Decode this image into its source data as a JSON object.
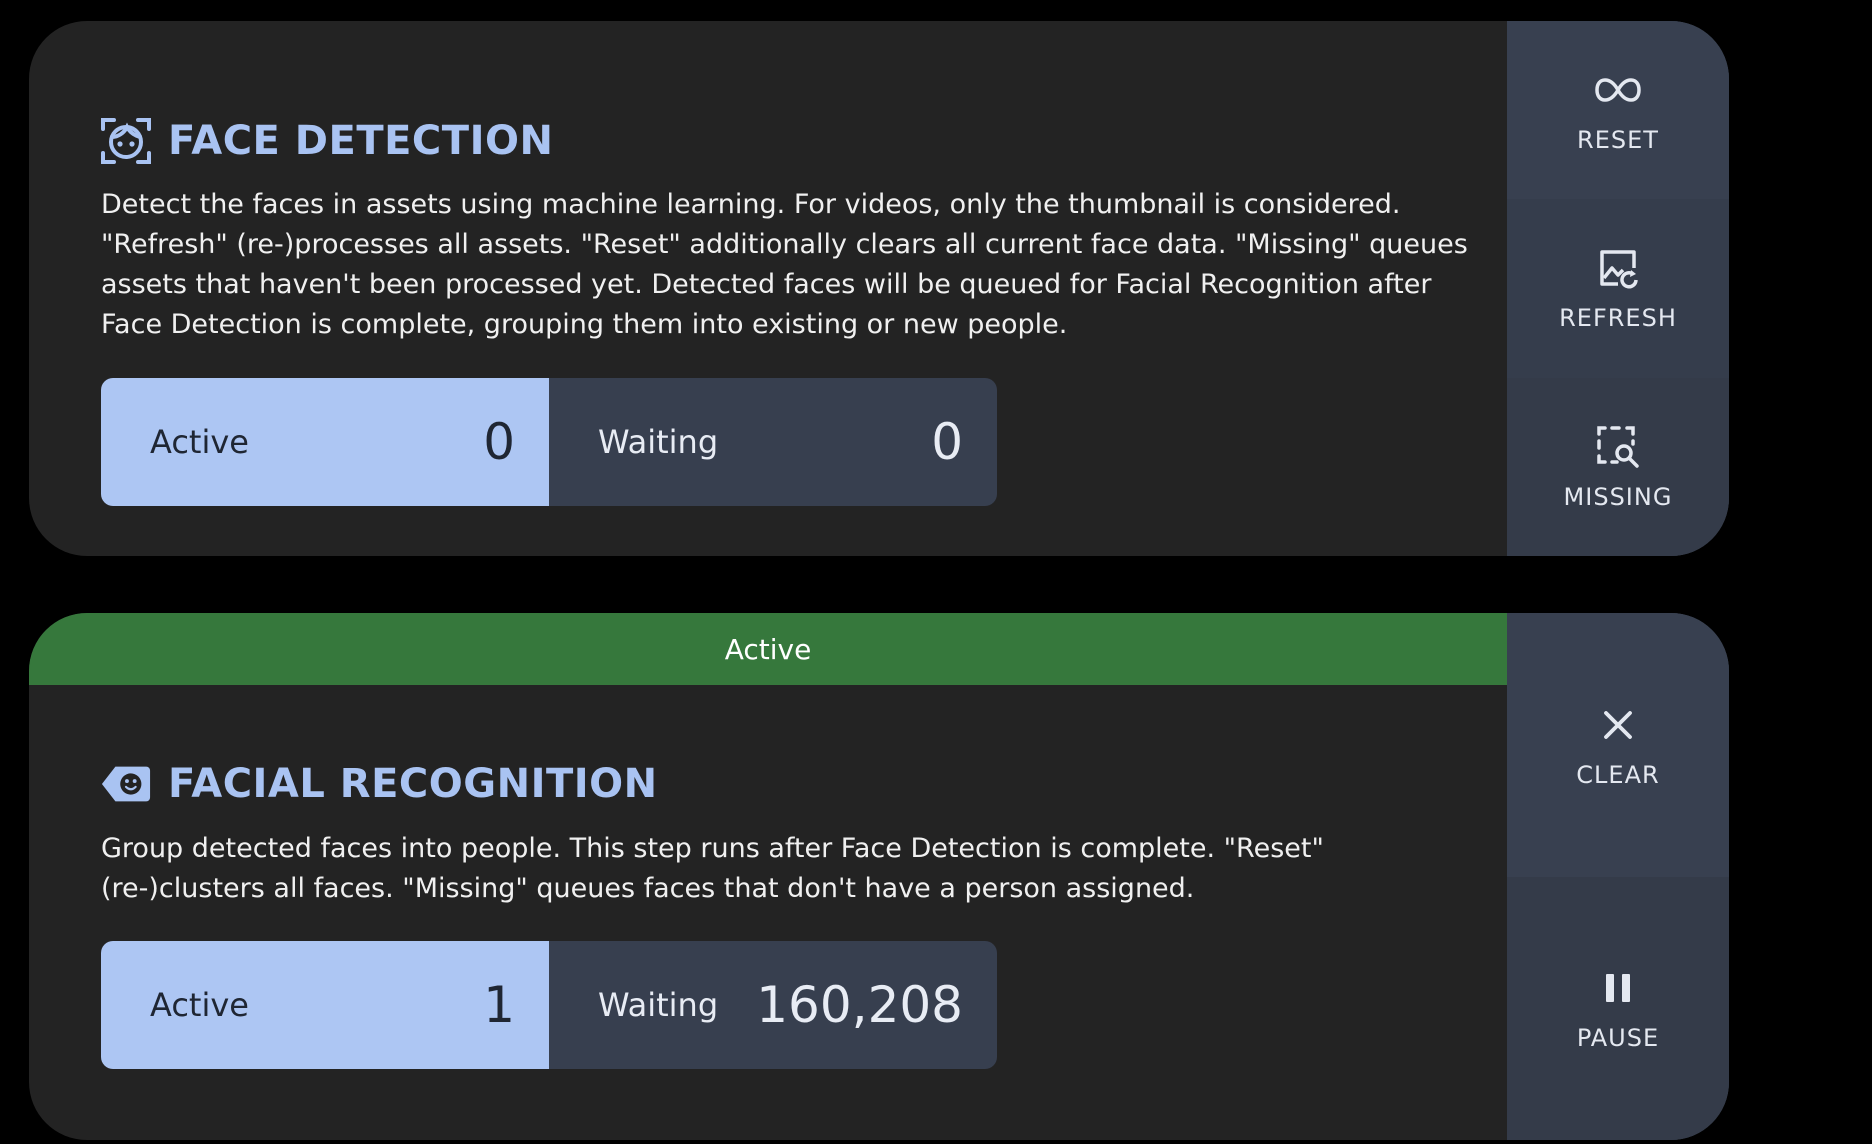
{
  "colors": {
    "background": "#000000",
    "card": "#232323",
    "accent": "#a9c3f2",
    "active_box": "#adc6f3",
    "waiting_box": "#373f4f",
    "side_panel": "#353d4d",
    "status_active": "#36783c"
  },
  "jobs": [
    {
      "title": "FACE DETECTION",
      "icon": "face-scan-icon",
      "description": "Detect the faces in assets using machine learning. For videos, only the thumbnail is considered. \"Refresh\" (re-)processes all assets. \"Reset\" additionally clears all current face data. \"Missing\" queues assets that haven't been processed yet. Detected faces will be queued for Facial Recognition after Face Detection is complete, grouping them into existing or new people.",
      "active_label": "Active",
      "active_count": "0",
      "waiting_label": "Waiting",
      "waiting_count": "0",
      "actions": [
        {
          "label": "RESET",
          "icon": "infinity-icon"
        },
        {
          "label": "REFRESH",
          "icon": "image-refresh-icon"
        },
        {
          "label": "MISSING",
          "icon": "select-search-icon"
        }
      ]
    },
    {
      "status": "Active",
      "title": "FACIAL RECOGNITION",
      "icon": "tag-face-icon",
      "description": "Group detected faces into people. This step runs after Face Detection is complete. \"Reset\" (re-)clusters all faces. \"Missing\" queues faces that don't have a person assigned.",
      "active_label": "Active",
      "active_count": "1",
      "waiting_label": "Waiting",
      "waiting_count": "160,208",
      "actions": [
        {
          "label": "CLEAR",
          "icon": "close-icon"
        },
        {
          "label": "PAUSE",
          "icon": "pause-icon"
        }
      ]
    }
  ]
}
